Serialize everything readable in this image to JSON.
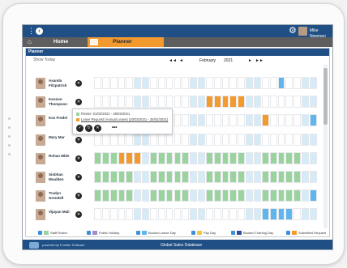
{
  "topbar": {
    "user_name": "Mike Newman"
  },
  "tabs": [
    {
      "label": "Home"
    },
    {
      "label": "Planner"
    }
  ],
  "section": {
    "title": "Planner",
    "show_today": "Show Today"
  },
  "nav": {
    "month": "February",
    "year": "2021",
    "prev": "◄◄",
    "prev_single": "◄",
    "next": "►",
    "next_fast": "►►"
  },
  "people": [
    {
      "name_line1": "Asanda",
      "name_line2": "Fitzpatrick"
    },
    {
      "name_line1": "Kenson",
      "name_line2": "Thompson"
    },
    {
      "name_line1": "Koz Fredel",
      "name_line2": ""
    },
    {
      "name_line1": "Mary Mar",
      "name_line2": ""
    },
    {
      "name_line1": "Rohan Mlds",
      "name_line2": ""
    },
    {
      "name_line1": "Siobhan",
      "name_line2": "Moulden"
    },
    {
      "name_line1": "Trudyn",
      "name_line2": "Grendell"
    },
    {
      "name_line1": "Vijayan Mali",
      "name_line2": ""
    }
  ],
  "popup": {
    "roster_text": "Roster: 01/02/2021 - 28/02/2021",
    "leave_text": "Leave Request (Annual Leave) (20/02/2021 - 26/02/2021)",
    "more": "•••"
  },
  "legend": [
    {
      "label": "Staff Roster",
      "color": "#9bd39e"
    },
    {
      "label": "Public Holiday",
      "color": "#a58bcc"
    },
    {
      "label": "Booked Leave Day",
      "color": "#5fb6ee"
    },
    {
      "label": "Pay Day",
      "color": "#f5c542"
    },
    {
      "label": "Booked Training Day",
      "color": "#2f4d9a"
    },
    {
      "label": "Submitted Request",
      "color": "#f39a2e"
    }
  ],
  "footer": {
    "powered": "powered by Frontier Software",
    "db_name": "Global Sales Database"
  },
  "colors": {
    "header_blue": "#1f4f84",
    "weekend": "#d6ebf8",
    "roster": "#9bd39e",
    "booked_leave": "#5fb6ee",
    "submitted": "#f39a2e",
    "planner_tab": "#f39a2e"
  }
}
